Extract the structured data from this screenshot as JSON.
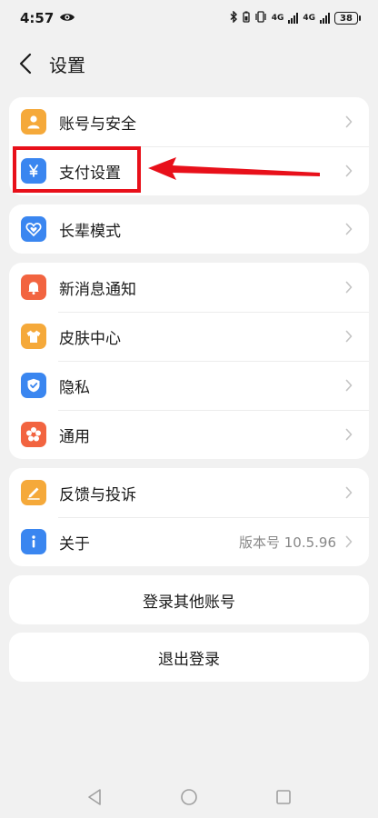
{
  "status_bar": {
    "time": "4:57",
    "net_1": "4G",
    "net_2": "4G",
    "battery": "38"
  },
  "header": {
    "title": "设置",
    "back_icon": "chevron-left-icon"
  },
  "groups": [
    {
      "items": [
        {
          "label": "账号与安全",
          "icon": "user-icon",
          "color": "#f5a93a"
        },
        {
          "label": "支付设置",
          "icon": "yuan-icon",
          "color": "#3a86f0"
        }
      ]
    },
    {
      "items": [
        {
          "label": "长辈模式",
          "icon": "heart-icon",
          "color": "#3a86f0"
        }
      ]
    },
    {
      "items": [
        {
          "label": "新消息通知",
          "icon": "bell-icon",
          "color": "#f26440"
        },
        {
          "label": "皮肤中心",
          "icon": "shirt-icon",
          "color": "#f5a93a"
        },
        {
          "label": "隐私",
          "icon": "shield-icon",
          "color": "#3a86f0"
        },
        {
          "label": "通用",
          "icon": "flower-icon",
          "color": "#f26440"
        }
      ]
    },
    {
      "items": [
        {
          "label": "反馈与投诉",
          "icon": "edit-icon",
          "color": "#f5a93a"
        },
        {
          "label": "关于",
          "icon": "info-icon",
          "color": "#3a86f0",
          "value": "版本号 10.5.96"
        }
      ]
    }
  ],
  "actions": {
    "login_other": "登录其他账号",
    "logout": "退出登录"
  },
  "annotation": {
    "highlight_color": "#e8101a",
    "target": "支付设置"
  }
}
